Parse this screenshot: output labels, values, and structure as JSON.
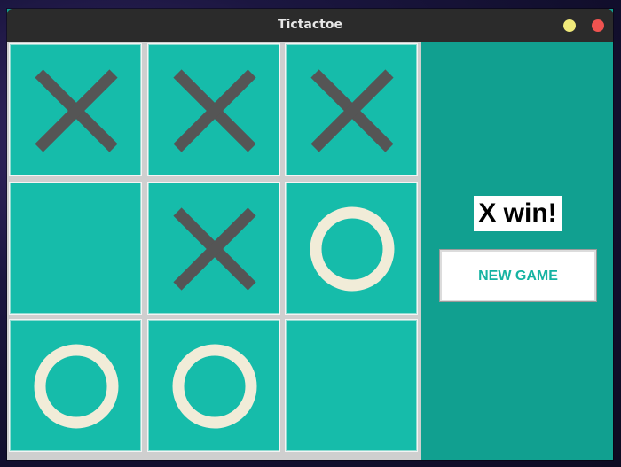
{
  "window": {
    "title": "Tictactoe",
    "min_color": "#f0e97a",
    "close_color": "#ef5350"
  },
  "board": {
    "cells": [
      [
        "X",
        "X",
        "X"
      ],
      [
        "",
        "X",
        "O"
      ],
      [
        "O",
        "O",
        ""
      ]
    ],
    "x_color": "#555555",
    "o_color": "#f1ecd8",
    "cell_color": "#16bcaa"
  },
  "side": {
    "status": "X win!",
    "new_game_label": "NEW GAME"
  }
}
